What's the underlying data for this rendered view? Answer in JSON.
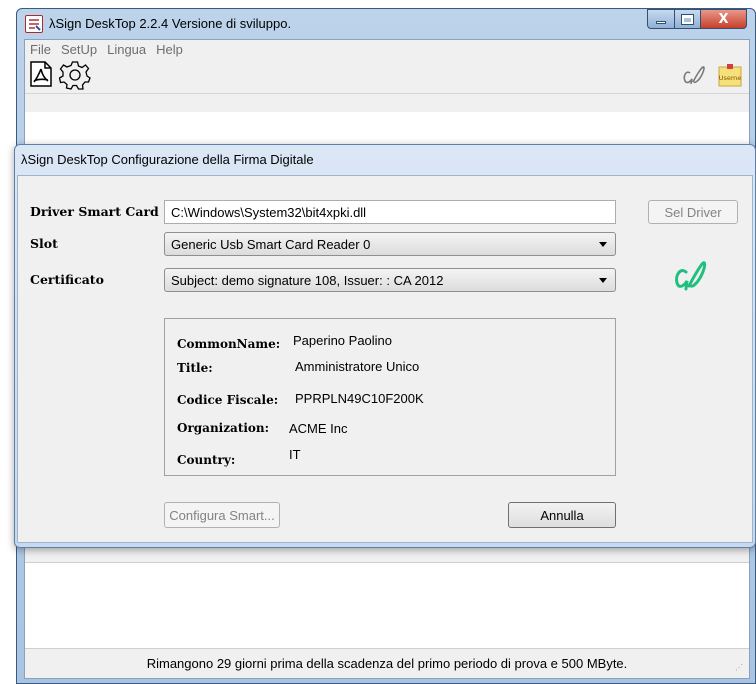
{
  "window": {
    "title": "λSign DeskTop  2.2.4 Versione di sviluppo.",
    "close_glyph": "X"
  },
  "menu": [
    "File",
    "SetUp",
    "Lingua",
    "Help"
  ],
  "toolbar": {
    "icons": [
      "pdf-icon",
      "gear-icon",
      "signature-icon",
      "sticky-note-icon"
    ],
    "sticky_note_text": "Useme"
  },
  "dialog": {
    "title": "λSign DeskTop Configurazione della Firma Digitale",
    "driver_label": "Driver Smart Card",
    "driver_value": "C:\\Windows\\System32\\bit4xpki.dll",
    "sel_driver_button": "Sel Driver",
    "slot_label": "Slot",
    "slot_value": "Generic Usb Smart Card Reader 0",
    "cert_label": "Certificato",
    "cert_value": "Subject: demo signature 108, Issuer: : CA 2012",
    "info": {
      "common_name_label": "CommonName:",
      "common_name_value": "Paperino Paolino",
      "title_label": "Title:",
      "title_value": "Amministratore Unico",
      "cf_label": "Codice Fiscale:",
      "cf_value": "PPRPLN49C10F200K",
      "org_label": "Organization:",
      "org_value": "ACME Inc",
      "country_label": "Country:",
      "country_value": "IT"
    },
    "configura_button": "Configura Smart...",
    "annulla_button": "Annulla"
  },
  "status": {
    "text": "Rimangono 29 giorni prima della scadenza del primo periodo di prova e 500 MByte."
  },
  "colors": {
    "signature_green": "#1fbf7f",
    "close_red": "#c7402c"
  }
}
